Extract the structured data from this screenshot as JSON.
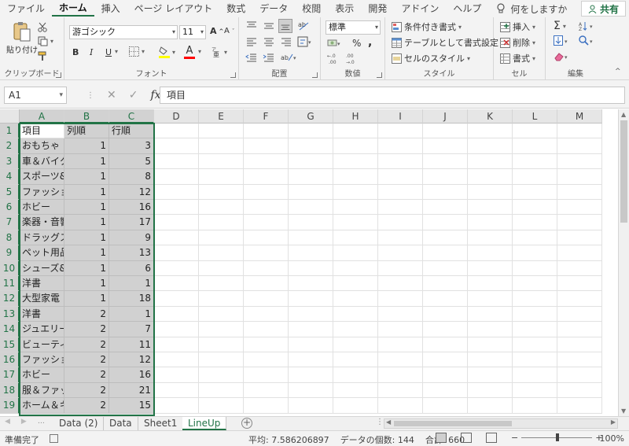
{
  "menu": {
    "items": [
      "ファイル",
      "ホーム",
      "挿入",
      "ページ レイアウト",
      "数式",
      "データ",
      "校閲",
      "表示",
      "開発",
      "アドイン",
      "ヘルプ"
    ],
    "active_index": 1,
    "tell_me": "何をしますか",
    "share": "共有"
  },
  "ribbon": {
    "clipboard": {
      "label": "クリップボード",
      "paste": "貼り付け"
    },
    "font": {
      "label": "フォント",
      "name": "游ゴシック",
      "size": "11",
      "bold": "B",
      "italic": "I",
      "underline": "U",
      "grow": "A",
      "shrink": "A",
      "color_letter": "A"
    },
    "alignment": {
      "label": "配置"
    },
    "number": {
      "label": "数値",
      "format": "標準",
      "percent": "%",
      "comma": ","
    },
    "styles": {
      "label": "スタイル",
      "conditional": "条件付き書式",
      "as_table": "テーブルとして書式設定",
      "cell_styles": "セルのスタイル"
    },
    "cells": {
      "label": "セル",
      "insert": "挿入",
      "delete": "削除",
      "format": "書式"
    },
    "editing": {
      "label": "編集",
      "sum": "Σ"
    }
  },
  "formula_bar": {
    "name_box": "A1",
    "cancel": "✕",
    "enter": "✓",
    "fx": "fx",
    "value": "項目"
  },
  "columns": [
    "A",
    "B",
    "C",
    "D",
    "E",
    "F",
    "G",
    "H",
    "I",
    "J",
    "K",
    "L",
    "M"
  ],
  "rows": [
    {
      "n": "1",
      "a": "項目",
      "b": "列順",
      "c": "行順"
    },
    {
      "n": "2",
      "a": "おもちゃ",
      "b": "1",
      "c": "3"
    },
    {
      "n": "3",
      "a": "車＆バイク",
      "b": "1",
      "c": "5"
    },
    {
      "n": "4",
      "a": "スポーツ&",
      "b": "1",
      "c": "8"
    },
    {
      "n": "5",
      "a": "ファッショ",
      "b": "1",
      "c": "12"
    },
    {
      "n": "6",
      "a": "ホビー",
      "b": "1",
      "c": "16"
    },
    {
      "n": "7",
      "a": "楽器・音響",
      "b": "1",
      "c": "17"
    },
    {
      "n": "8",
      "a": "ドラッグス",
      "b": "1",
      "c": "9"
    },
    {
      "n": "9",
      "a": "ペット用品",
      "b": "1",
      "c": "13"
    },
    {
      "n": "10",
      "a": "シューズ&",
      "b": "1",
      "c": "6"
    },
    {
      "n": "11",
      "a": "洋書",
      "b": "1",
      "c": "1"
    },
    {
      "n": "12",
      "a": "大型家電",
      "b": "1",
      "c": "18"
    },
    {
      "n": "13",
      "a": "洋書",
      "b": "2",
      "c": "1"
    },
    {
      "n": "14",
      "a": "ジュエリー",
      "b": "2",
      "c": "7"
    },
    {
      "n": "15",
      "a": "ビューティ",
      "b": "2",
      "c": "11"
    },
    {
      "n": "16",
      "a": "ファッショ",
      "b": "2",
      "c": "12"
    },
    {
      "n": "17",
      "a": "ホビー",
      "b": "2",
      "c": "16"
    },
    {
      "n": "18",
      "a": "服＆ファッ",
      "b": "2",
      "c": "21"
    },
    {
      "n": "19",
      "a": "ホーム＆キ",
      "b": "2",
      "c": "15"
    }
  ],
  "sheet_tabs": [
    "Data (2)",
    "Data",
    "Sheet1",
    "LineUp"
  ],
  "active_tab_index": 3,
  "status": {
    "ready": "準備完了",
    "average": "平均: 7.586206897",
    "count": "データの個数: 144",
    "sum": "合計: 660",
    "zoom": "100%",
    "zoom_level": 1.0
  },
  "colors": {
    "accent": "#217346",
    "selection_fill": "#d1d1d1"
  }
}
